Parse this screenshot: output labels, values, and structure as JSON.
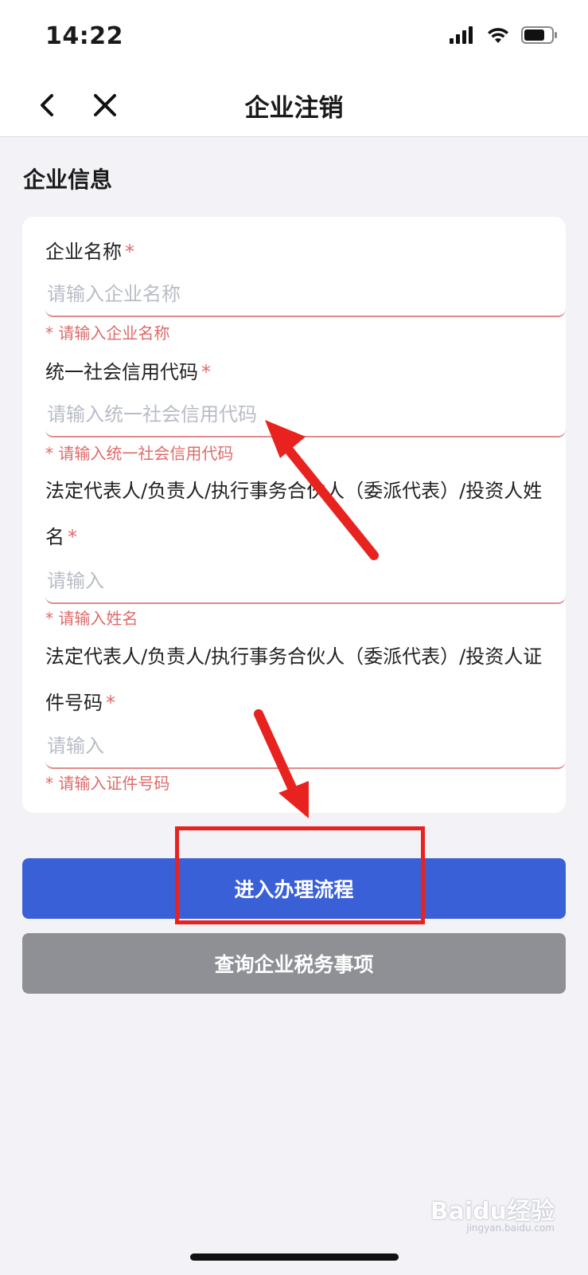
{
  "status": {
    "time": "14:22"
  },
  "nav": {
    "title": "企业注销"
  },
  "section": {
    "title": "企业信息"
  },
  "form": {
    "fields": [
      {
        "label": "企业名称",
        "required_mark": "*",
        "placeholder": "请输入企业名称",
        "error": "* 请输入企业名称"
      },
      {
        "label": "统一社会信用代码",
        "required_mark": "*",
        "placeholder": "请输入统一社会信用代码",
        "error": "* 请输入统一社会信用代码"
      },
      {
        "label": "法定代表人/负责人/执行事务合伙人（委派代表）/投资人姓名",
        "required_mark": "*",
        "placeholder": "请输入",
        "error": "* 请输入姓名"
      },
      {
        "label": "法定代表人/负责人/执行事务合伙人（委派代表）/投资人证件号码",
        "required_mark": "*",
        "placeholder": "请输入",
        "error": "* 请输入证件号码"
      }
    ]
  },
  "buttons": {
    "primary": "进入办理流程",
    "secondary": "查询企业税务事项"
  },
  "watermark": {
    "brand": "Baidu经验",
    "sub": "jingyan.baidu.com"
  },
  "colors": {
    "primary_button": "#3a60d8",
    "secondary_button": "#8e9096",
    "error": "#e06a6a",
    "annotation": "#e8231f"
  }
}
